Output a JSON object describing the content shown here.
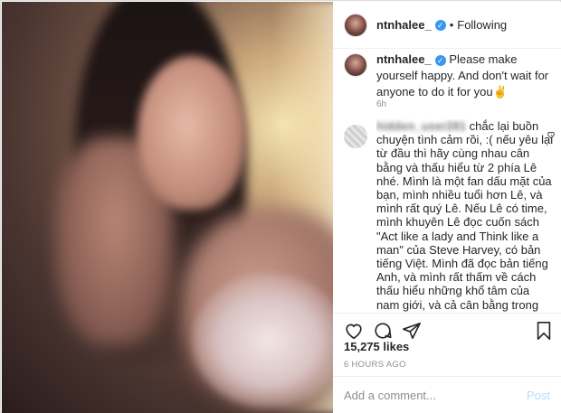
{
  "post": {
    "username": "ntnhalee_",
    "follow_state": "Following",
    "separator": "•",
    "caption": "Please make yourself happy. And don't wait for anyone to do it for you✌️",
    "caption_time": "6h",
    "likes": "15,275 likes",
    "posted_ago": "6 HOURS AGO"
  },
  "comment": {
    "author_blurred": "hidden_user281",
    "text": "chắc lại buồn chuyện tình cảm rồi, :( nếu yêu lại từ đầu thì hãy cùng nhau cân bằng và thấu hiểu từ 2 phía Lê nhé. Mình là một fan dấu mặt của bạn, mình nhiều tuổi hơn Lê, và mình rất quý Lê. Nếu Lê có time, mình khuyên Lê đọc cuốn sách \"Act like a lady and Think like a man\" của Steve Harvey, có bản tiếng Việt. Mình đã đọc bản tiếng Anh, và mình rất thấm về cách thấu hiểu những khổ tâm của nam giới, và cả cân bằng trong tình cảm. Hải là một người tốt, tử tế, mình tin là"
  },
  "comment_box": {
    "placeholder": "Add a comment...",
    "post_label": "Post"
  },
  "colors": {
    "verified": "#3897f0",
    "post_disabled": "#b2dffc",
    "muted": "#8e8e8e"
  },
  "icons": [
    "verified-badge-icon",
    "heart-icon",
    "comment-icon",
    "share-icon",
    "bookmark-icon",
    "small-heart-icon"
  ]
}
